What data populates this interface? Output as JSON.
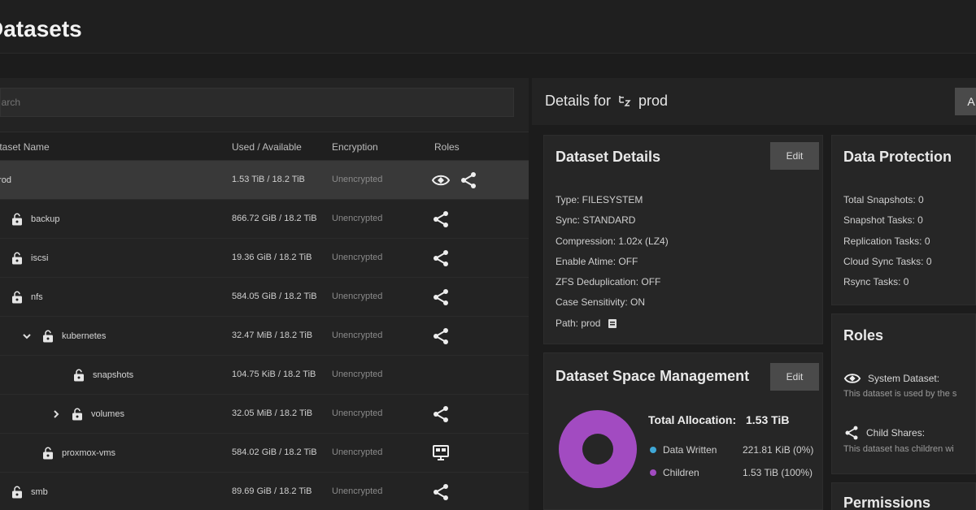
{
  "page": {
    "title": "Datasets"
  },
  "search": {
    "placeholder": "Search"
  },
  "table": {
    "columns": [
      "Dataset Name",
      "Used / Available",
      "Encryption",
      "Roles"
    ],
    "rows": [
      {
        "name": "prod",
        "used": "1.53 TiB / 18.2 TiB",
        "encryption": "Unencrypted",
        "roles": [
          "system-dataset-icon",
          "share-icon"
        ]
      },
      {
        "name": "backup",
        "used": "866.72 GiB / 18.2 TiB",
        "encryption": "Unencrypted",
        "roles": [
          "share-icon"
        ]
      },
      {
        "name": "iscsi",
        "used": "19.36 GiB / 18.2 TiB",
        "encryption": "Unencrypted",
        "roles": [
          "share-icon"
        ]
      },
      {
        "name": "nfs",
        "used": "584.05 GiB / 18.2 TiB",
        "encryption": "Unencrypted",
        "roles": [
          "share-icon"
        ]
      },
      {
        "name": "kubernetes",
        "used": "32.47 MiB / 18.2 TiB",
        "encryption": "Unencrypted",
        "roles": [
          "share-icon"
        ]
      },
      {
        "name": "snapshots",
        "used": "104.75 KiB / 18.2 TiB",
        "encryption": "Unencrypted",
        "roles": []
      },
      {
        "name": "volumes",
        "used": "32.05 MiB / 18.2 TiB",
        "encryption": "Unencrypted",
        "roles": [
          "share-icon"
        ]
      },
      {
        "name": "proxmox-vms",
        "used": "584.02 GiB / 18.2 TiB",
        "encryption": "Unencrypted",
        "roles": [
          "vm-icon"
        ]
      },
      {
        "name": "smb",
        "used": "89.69 GiB / 18.2 TiB",
        "encryption": "Unencrypted",
        "roles": [
          "share-icon"
        ]
      }
    ]
  },
  "details": {
    "header": "Details for",
    "dataset": "prod",
    "add_label": "A"
  },
  "dataset_details": {
    "title": "Dataset Details",
    "edit_label": "Edit",
    "items": [
      "Type: FILESYSTEM",
      "Sync: STANDARD",
      "Compression: 1.02x (LZ4)",
      "Enable Atime: OFF",
      "ZFS Deduplication: OFF",
      "Case Sensitivity: ON",
      "Path: prod"
    ]
  },
  "data_protection": {
    "title": "Data Protection",
    "items": [
      "Total Snapshots: 0",
      "Snapshot Tasks: 0",
      "Replication Tasks: 0",
      "Cloud Sync Tasks: 0",
      "Rsync Tasks: 0"
    ]
  },
  "space_management": {
    "title": "Dataset Space Management",
    "edit_label": "Edit",
    "total_label": "Total Allocation:",
    "total_value": "1.53 TiB",
    "legend": [
      {
        "label": "Data Written",
        "value": "221.81 KiB (0%)",
        "color": "#3fa7d6"
      },
      {
        "label": "Children",
        "value": "1.53 TiB (100%)",
        "color": "#a24bc1"
      }
    ]
  },
  "roles": {
    "title": "Roles",
    "items": [
      {
        "label": "System Dataset:",
        "desc": "This dataset is used by the s"
      },
      {
        "label": "Child Shares:",
        "desc": "This dataset has children wi"
      }
    ]
  },
  "permissions": {
    "title": "Permissions"
  }
}
